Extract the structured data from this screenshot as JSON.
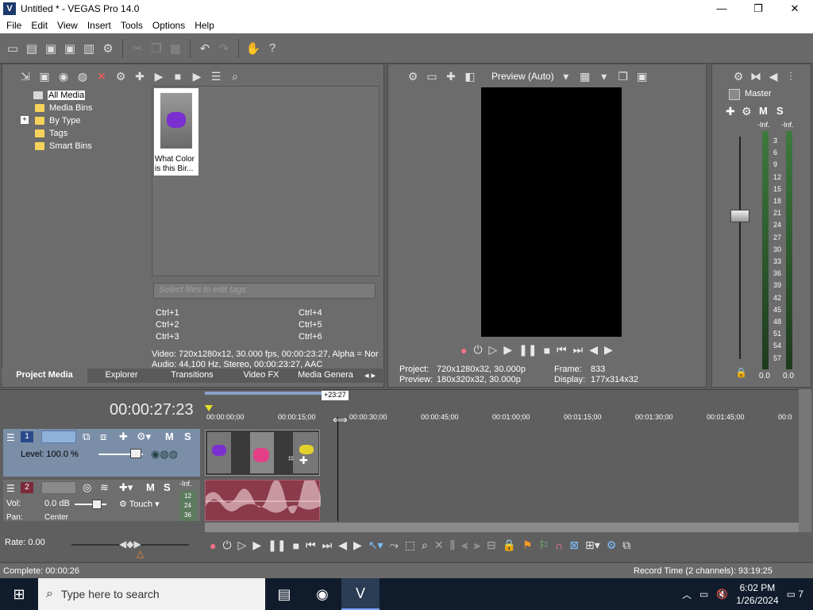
{
  "window": {
    "title": "Untitled * - VEGAS Pro 14.0",
    "minimize": "—",
    "maximize": "❐",
    "close": "✕"
  },
  "menu": [
    "File",
    "Edit",
    "View",
    "Insert",
    "Tools",
    "Options",
    "Help"
  ],
  "media": {
    "tree": [
      "All Media",
      "Media Bins",
      "By Type",
      "Tags",
      "Smart Bins"
    ],
    "expander": "+",
    "thumb_caption": "What Color is this Bir...",
    "tags_placeholder": "Select files to edit tags",
    "shortcuts": [
      "Ctrl+1",
      "Ctrl+4",
      "Ctrl+2",
      "Ctrl+5",
      "Ctrl+3",
      "Ctrl+6"
    ],
    "video_info": "Video: 720x1280x12, 30.000 fps, 00:00:23:27, Alpha = Nor",
    "audio_info": "Audio: 44,100 Hz, Stereo, 00:00:23:27, AAC",
    "tabs": [
      "Project Media",
      "Explorer",
      "Transitions",
      "Video FX",
      "Media Genera"
    ]
  },
  "preview": {
    "mode": "Preview (Auto)",
    "project_label": "Project:",
    "project_value": "720x1280x32, 30.000p",
    "preview_label": "Preview:",
    "preview_value": "180x320x32, 30.000p",
    "frame_label": "Frame:",
    "frame_value": "833",
    "display_label": "Display:",
    "display_value": "177x314x32"
  },
  "mixer": {
    "title": "Master",
    "m": "M",
    "s": "S",
    "inf_left": "-Inf.",
    "inf_right": "-Inf.",
    "scale": [
      "3",
      "6",
      "9",
      "12",
      "15",
      "18",
      "21",
      "24",
      "27",
      "30",
      "33",
      "36",
      "39",
      "42",
      "45",
      "48",
      "51",
      "54",
      "57"
    ],
    "bottom_left": "0.0",
    "bottom_right": "0.0"
  },
  "timeline": {
    "timecode": "00:00:27:23",
    "region_label": "+23:27",
    "ruler": [
      "00:00:00;00",
      "00:00:15;00",
      "00:00:30;00",
      "00:00:45;00",
      "00:01:00;00",
      "00:01:15;00",
      "00:01:30;00",
      "00:01:45;00",
      "00:0"
    ],
    "track1": {
      "number": "1",
      "level": "Level: 100.0 %",
      "m": "M",
      "s": "S"
    },
    "track2": {
      "number": "2",
      "vol": "Vol:",
      "vol_value": "0.0 dB",
      "pan": "Pan:",
      "pan_value": "Center",
      "mode": "Touch",
      "m": "M",
      "s": "S",
      "inf": "-Inf.",
      "meter": [
        "12",
        "24",
        "36"
      ]
    },
    "rate": "Rate: 0.00"
  },
  "status": {
    "complete": "Complete: 00:00:26",
    "record_time": "Record Time (2 channels): 93:19:25"
  },
  "taskbar": {
    "search_placeholder": "Type here to search",
    "time": "6:02 PM",
    "date": "1/26/2024",
    "notifications": "7"
  }
}
